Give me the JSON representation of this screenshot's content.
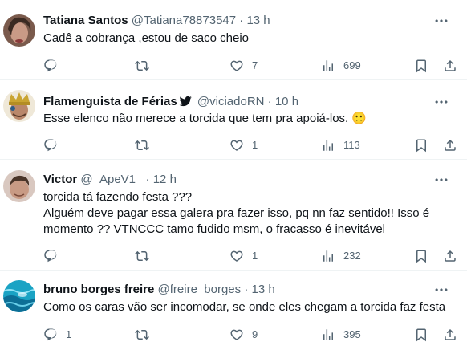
{
  "colors": {
    "text": "#0f1419",
    "secondary": "#536471",
    "divider": "#eff3f4",
    "verified": "#0f1419"
  },
  "icons": {
    "reply": "reply-icon",
    "retweet": "retweet-icon",
    "like": "heart-icon",
    "views": "views-icon",
    "bookmark": "bookmark-icon",
    "share": "share-icon",
    "more": "more-icon"
  },
  "tweets": [
    {
      "name": "Tatiana Santos",
      "handle": "@Tatiana78873547",
      "separator": "·",
      "time": "13 h",
      "text": "Cadê a cobrança ,estou de saco cheio",
      "reply_count": "",
      "retweet_count": "",
      "like_count": "7",
      "view_count": "699"
    },
    {
      "name": "Flamenguista de Férias",
      "handle": "@viciadoRN",
      "separator": "·",
      "time": "10 h",
      "text": "Esse elenco não merece a torcida que tem pra apoiá-los. 🙁",
      "reply_count": "",
      "retweet_count": "",
      "like_count": "1",
      "view_count": "113"
    },
    {
      "name": "Victor",
      "handle": "@_ApeV1_",
      "separator": "·",
      "time": "12 h",
      "lines": [
        "torcida tá fazendo festa ???",
        "Alguém deve pagar essa galera pra fazer isso, pq nn faz sentido!! Isso é",
        "momento ?? VTNCCC tamo fudido msm, o fracasso é inevitável"
      ],
      "reply_count": "",
      "retweet_count": "",
      "like_count": "1",
      "view_count": "232"
    },
    {
      "name": "bruno borges freire",
      "handle": "@freire_borges",
      "separator": "·",
      "time": "13 h",
      "text": "Como os caras vão ser incomodar, se onde eles chegam a torcida faz festa",
      "reply_count": "1",
      "retweet_count": "",
      "like_count": "9",
      "view_count": "395"
    }
  ]
}
